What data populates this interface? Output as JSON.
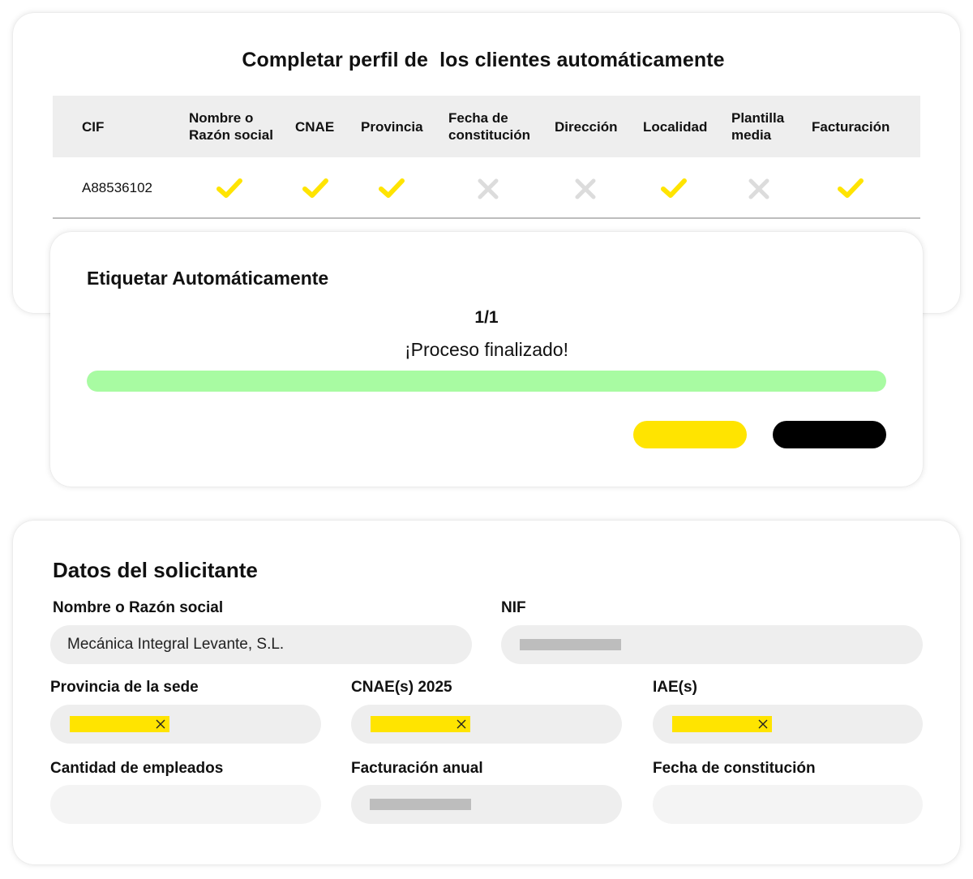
{
  "enrichment": {
    "title": "Completar perfil de  los clientes automáticamente",
    "columns": [
      "CIF",
      "Nombre o\nRazón social",
      "CNAE",
      "Provincia",
      "Fecha de\nconstitución",
      "Dirección",
      "Localidad",
      "Plantilla\nmedia",
      "Facturación"
    ],
    "row": {
      "cif": "A88536102",
      "status": [
        "check",
        "check",
        "check",
        "cross",
        "cross",
        "check",
        "cross",
        "check"
      ],
      "status_icons": {
        "check": "checkmark-icon",
        "cross": "cross-icon"
      }
    }
  },
  "tagging_modal": {
    "title": "Etiquetar Automáticamente",
    "count": "1/1",
    "status": "¡Proceso finalizado!",
    "progress_fraction": 1.0
  },
  "applicant_form": {
    "title": "Datos del solicitante",
    "fields": {
      "name": {
        "label": "Nombre o Razón social",
        "value": "Mecánica Integral Levante, S.L."
      },
      "nif": {
        "label": "NIF"
      },
      "province": {
        "label": "Provincia de la sede"
      },
      "cnae": {
        "label": "CNAE(s) 2025"
      },
      "iae": {
        "label": "IAE(s)"
      },
      "employees": {
        "label": "Cantidad de empleados"
      },
      "revenue": {
        "label": "Facturación anual"
      },
      "founded": {
        "label": "Fecha de constitución"
      }
    }
  },
  "colors": {
    "accent_yellow": "#ffe400",
    "progress_green": "#a8fba2",
    "field_gray": "#eeeeee",
    "check": "#ffe400",
    "cross": "#dcdcdc",
    "black": "#000000"
  }
}
